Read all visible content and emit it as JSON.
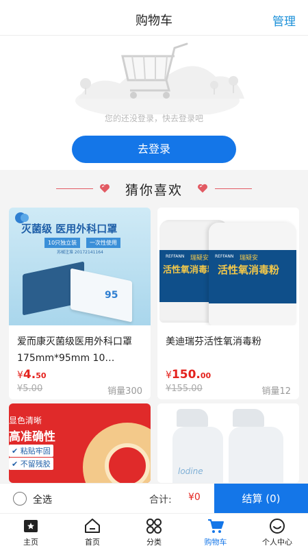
{
  "header": {
    "title": "购物车",
    "manage_label": "管理"
  },
  "empty_cart": {
    "hint": "您的还没登录，快去登录吧",
    "login_label": "去登录"
  },
  "guess": {
    "title": "猜你喜欢"
  },
  "products": [
    {
      "name": "爱而康灭菌级医用外科口罩 175mm*95mm 10…",
      "price_symbol": "¥",
      "price_int": "4.",
      "price_dec": "50",
      "original_price": "¥5.00",
      "sales": "销量300",
      "image_text": {
        "heading": "灭菌级 医用外科口罩",
        "tag1": "10只独立装",
        "tag2": "一次性使用",
        "reg": "苏械注准 20172141164",
        "num": "95"
      }
    },
    {
      "name": "美迪瑞芬活性氧消毒粉",
      "price_symbol": "¥",
      "price_int": "150.",
      "price_dec": "00",
      "original_price": "¥155.00",
      "sales": "销量12",
      "image_text": {
        "brand": "REFFANN",
        "brand_cn": "瑞疑安",
        "label": "活性氧消毒粉"
      }
    },
    {
      "image_text": {
        "line1": "显色清晰",
        "line2": "高准确性",
        "badge1": "粘贴牢固",
        "badge2": "不留残胶"
      }
    },
    {
      "image_text": {
        "brand": "lodine"
      }
    }
  ],
  "bottom_bar": {
    "select_all": "全选",
    "total_label": "合计:",
    "total_value": "¥0",
    "checkout_label": "结算 (0)"
  },
  "tabs": [
    {
      "label": "主页",
      "icon": "star-bag-icon",
      "active": false
    },
    {
      "label": "首页",
      "icon": "home-icon",
      "active": false
    },
    {
      "label": "分类",
      "icon": "grid-icon",
      "active": false
    },
    {
      "label": "购物车",
      "icon": "cart-icon",
      "active": true
    },
    {
      "label": "个人中心",
      "icon": "smile-icon",
      "active": false
    }
  ],
  "colors": {
    "accent": "#1476e8",
    "price": "#e4231e",
    "manage": "#1a8fd8"
  }
}
